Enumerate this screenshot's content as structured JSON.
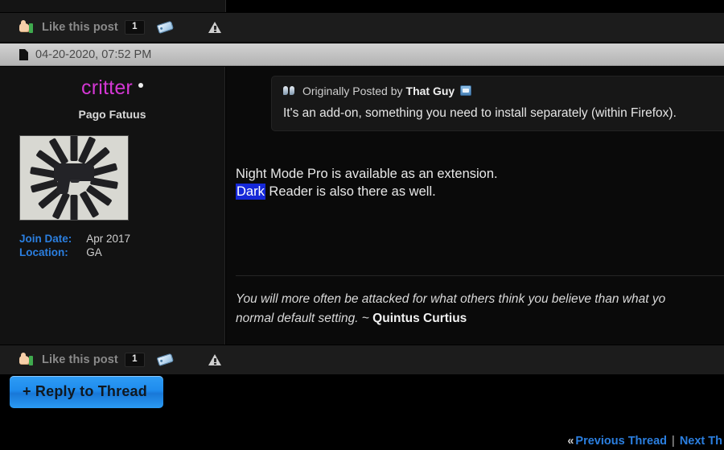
{
  "post": {
    "date": "04-20-2020, 07:52 PM",
    "author": {
      "username": "critter",
      "usertitle": "Pago Fatuus",
      "join_date_label": "Join Date:",
      "join_date_value": "Apr 2017",
      "location_label": "Location:",
      "location_value": "GA",
      "avatar_alt": "handgun-and-magazines-avatar"
    },
    "quote": {
      "prefix": "Originally Posted by",
      "author": "That Guy",
      "text": "It's an add-on, something you need to install separately (within Firefox)."
    },
    "message_line1": "Night Mode Pro is available as an extension.",
    "message_line2_highlight": "Dark",
    "message_line2_rest": " Reader is also there as well.",
    "signature_line1": "You will more often be attacked for what others think you believe than what yo",
    "signature_line2_italic": "normal default setting. ~ ",
    "signature_line2_bold": "Quintus Curtius"
  },
  "likebar": {
    "label": "Like this post",
    "count": "1",
    "thumb_icon": "thumbs-up-icon",
    "tag_icon": "tag-icon",
    "report_icon": "warning-triangle-icon"
  },
  "actions": {
    "reply_label": "+ Reply to Thread"
  },
  "bottom_nav": {
    "chevron": "«",
    "previous": "Previous Thread",
    "separator": "|",
    "next": "Next Th"
  },
  "colors": {
    "username": "#d437d4",
    "link": "#2b7fe0",
    "highlight": "#1528d8",
    "reply_button": "#1f8ced"
  }
}
